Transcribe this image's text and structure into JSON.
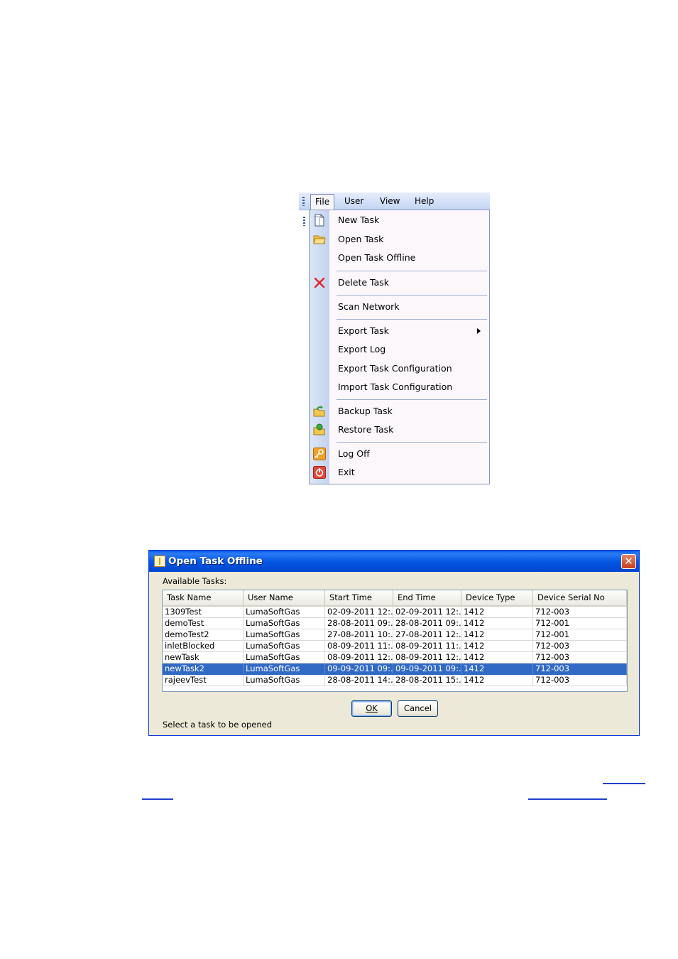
{
  "menu": {
    "bar_items": [
      "File",
      "User",
      "View",
      "Help"
    ],
    "items": [
      {
        "label": "New Task",
        "icon": "new-document-icon"
      },
      {
        "label": "Open Task",
        "icon": "open-folder-icon"
      },
      {
        "label": "Open Task Offline",
        "icon": ""
      },
      {
        "label": "Delete Task",
        "icon": "delete-x-icon"
      },
      {
        "label": "Scan Network",
        "icon": ""
      },
      {
        "label": "Export Task",
        "icon": "",
        "submenu": true
      },
      {
        "label": "Export Log",
        "icon": ""
      },
      {
        "label": "Export Task Configuration",
        "icon": ""
      },
      {
        "label": "Import Task Configuration",
        "icon": ""
      },
      {
        "label": "Backup Task",
        "icon": "backup-folder-icon"
      },
      {
        "label": "Restore Task",
        "icon": "restore-folder-icon"
      },
      {
        "label": "Log Off",
        "icon": "key-icon"
      },
      {
        "label": "Exit",
        "icon": "power-icon"
      }
    ]
  },
  "dialog": {
    "title": "Open Task Offline",
    "available_label": "Available Tasks:",
    "columns": [
      "Task Name",
      "User Name",
      "Start Time",
      "End Time",
      "Device Type",
      "Device Serial No"
    ],
    "rows": [
      [
        "1309Test",
        "LumaSoftGas",
        "02-09-2011 12:...",
        "02-09-2011 12:...",
        "1412",
        "712-003"
      ],
      [
        "demoTest",
        "LumaSoftGas",
        "28-08-2011 09:...",
        "28-08-2011 09:...",
        "1412",
        "712-001"
      ],
      [
        "demoTest2",
        "LumaSoftGas",
        "27-08-2011 10:...",
        "27-08-2011 12:...",
        "1412",
        "712-001"
      ],
      [
        "inletBlocked",
        "LumaSoftGas",
        "08-09-2011 11:...",
        "08-09-2011 11:...",
        "1412",
        "712-003"
      ],
      [
        "newTask",
        "LumaSoftGas",
        "08-09-2011 12:...",
        "08-09-2011 12:...",
        "1412",
        "712-003"
      ],
      [
        "newTask2",
        "LumaSoftGas",
        "09-09-2011 09:...",
        "09-09-2011 09:...",
        "1412",
        "712-003"
      ],
      [
        "rajeevTest",
        "LumaSoftGas",
        "28-08-2011 14:...",
        "28-08-2011 15:...",
        "1412",
        "712-003"
      ]
    ],
    "selected_row": 5,
    "ok_label": "OK",
    "cancel_label": "Cancel",
    "status": "Select a task to be opened",
    "close_symbol": "✕"
  },
  "colors": {
    "title_bar": "#0a5ee8",
    "selection": "#316ac5",
    "dialog_face": "#ece9d8",
    "menu_strip": "#c2d3ef"
  }
}
